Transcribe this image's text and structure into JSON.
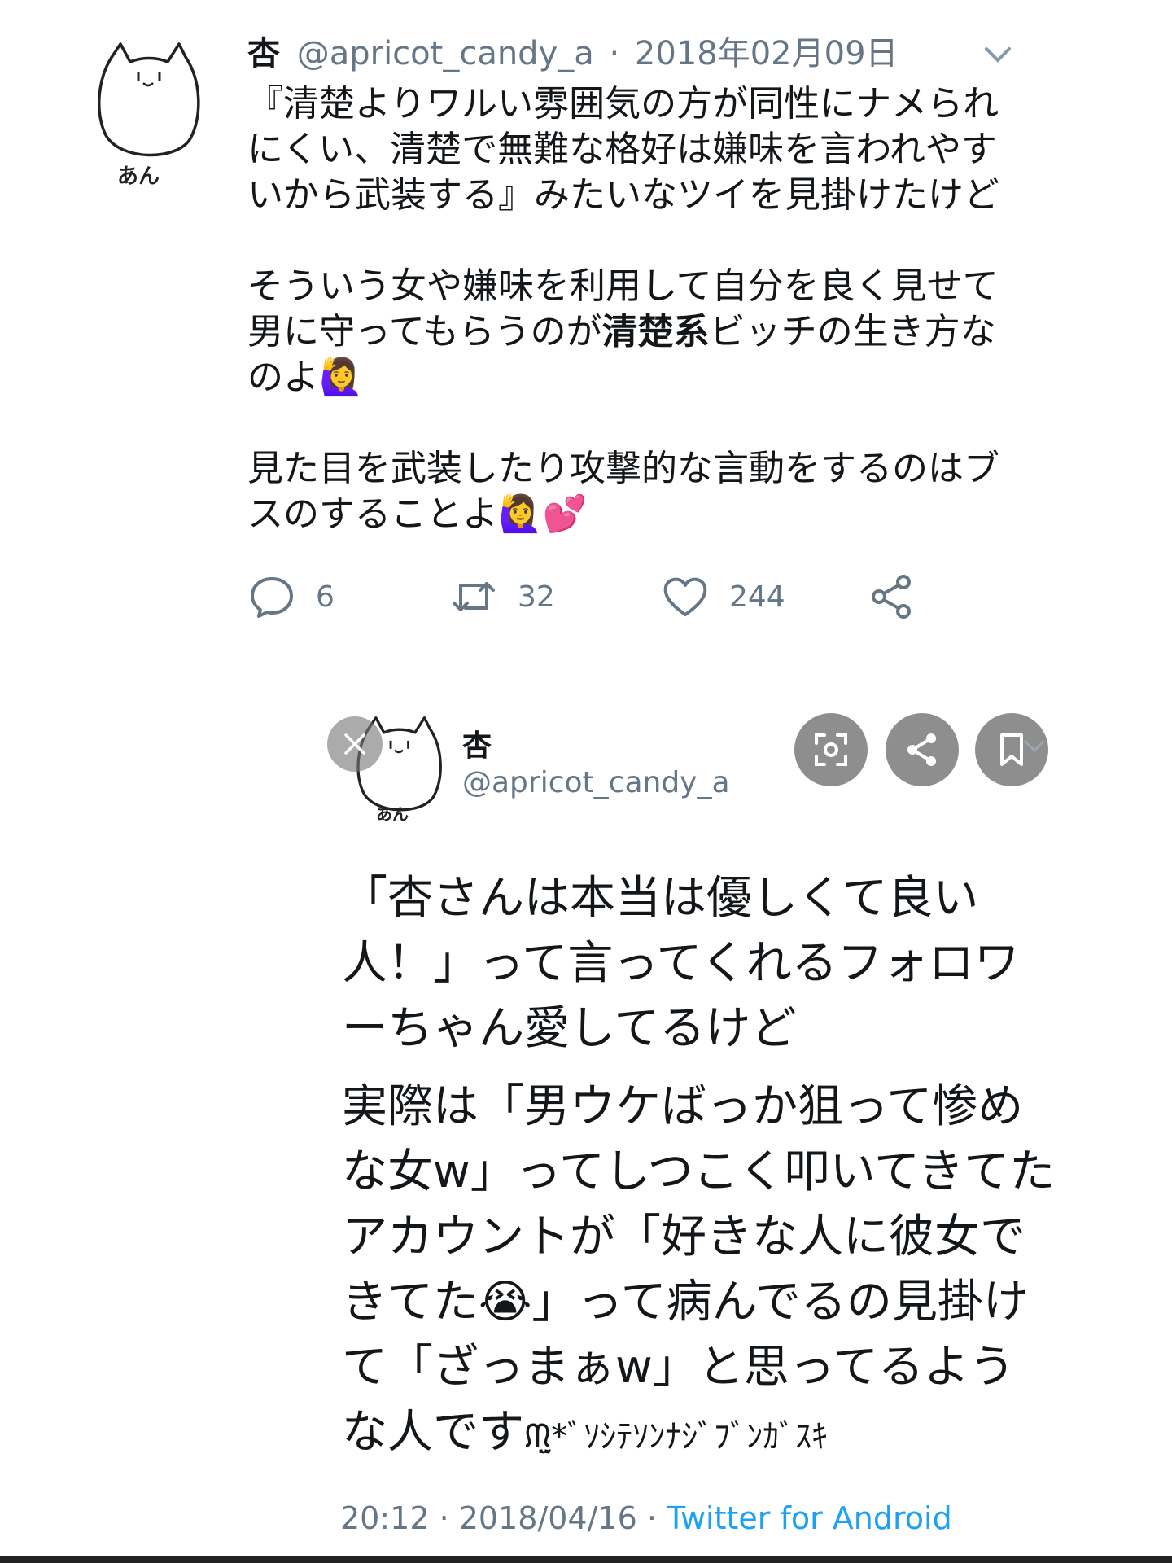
{
  "tweet1": {
    "author_name": "杏",
    "handle": "@apricot_candy_a",
    "date": "2018年02月09日",
    "avatar_label": "あん",
    "paragraphs": [
      "『清楚よりワルい雰囲気の方が同性にナメられ\nにくい、清楚で無難な格好は嫌味を言われやす\nいから武装する』みたいなツイを見掛けたけど",
      "そういう女や嫌味を利用して自分を良く見せて\n男に守ってもらうのが",
      "見た目を武装したり攻撃的な言動をするのはブ\nスのすることよ🙋‍♀️💕"
    ],
    "p2_bold": "清楚系",
    "p2_after": "ビッチの生き方な\nのよ🙋‍♀️",
    "actions": {
      "reply_count": "6",
      "retweet_count": "32",
      "like_count": "244"
    }
  },
  "tweet2": {
    "author_name": "杏",
    "handle": "@apricot_candy_a",
    "avatar_label": "あん",
    "paragraphs": [
      "「杏さんは本当は優しくて良い\n人！」って言ってくれるフォロワ\nーちゃん愛してるけど",
      "実際は「男ウケばっか狙って惨め\nな女w」ってしつこく叩いてきてた\nアカウントが「好きな人に彼女で\nきてた😭」って病んでるの見掛け\nて「ざっまぁw」と思ってるよう\nな人です"
    ],
    "kaomoji": "ᙏ̤̫*ﾞｿｼﾃｿﾝﾅｼﾞﾌﾞﾝｶﾞｽｷ",
    "footer_time": "20:12 · 2018/04/16 · ",
    "footer_source": "Twitter for Android"
  },
  "icons": [
    "cat-avatar-icon",
    "chevron-down-icon",
    "reply-icon",
    "retweet-icon",
    "like-icon",
    "share-icon",
    "close-icon",
    "lens-icon",
    "bookmark-icon"
  ],
  "colors": {
    "secondary_text": "#657786",
    "link": "#1da1f2",
    "overlay_button": "#8e8e8e"
  }
}
